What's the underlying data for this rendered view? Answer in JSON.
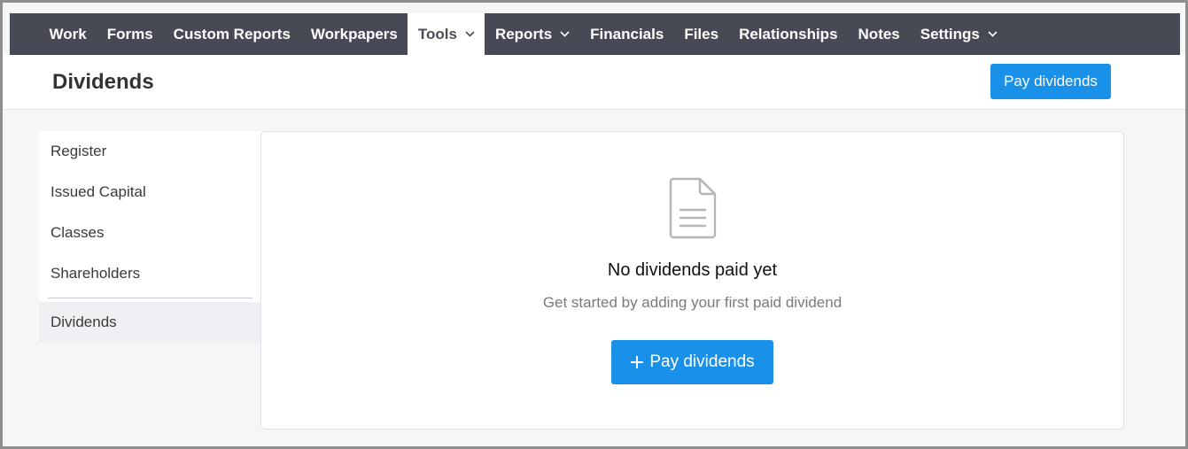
{
  "nav": {
    "items": [
      {
        "label": "Work"
      },
      {
        "label": "Forms"
      },
      {
        "label": "Custom Reports"
      },
      {
        "label": "Workpapers"
      },
      {
        "label": "Tools",
        "dropdown": true,
        "active": true
      },
      {
        "label": "Reports",
        "dropdown": true
      },
      {
        "label": "Financials"
      },
      {
        "label": "Files"
      },
      {
        "label": "Relationships"
      },
      {
        "label": "Notes"
      },
      {
        "label": "Settings",
        "dropdown": true
      }
    ],
    "chevron_icon": "chevron-down-icon"
  },
  "header": {
    "title": "Dividends",
    "action_label": "Pay dividends"
  },
  "sidebar": {
    "items": [
      {
        "label": "Register"
      },
      {
        "label": "Issued Capital"
      },
      {
        "label": "Classes"
      },
      {
        "label": "Shareholders"
      },
      {
        "label": "Dividends",
        "active": true
      }
    ]
  },
  "empty_state": {
    "icon": "document-icon",
    "title": "No dividends paid yet",
    "subtitle": "Get started by adding your first paid dividend",
    "button_label": "Pay dividends",
    "button_icon": "plus-icon"
  },
  "colors": {
    "nav_bg": "#474a55",
    "accent": "#1a91e8",
    "active_nav_bg": "#ffffff",
    "active_side_bg": "#eff0f3"
  }
}
